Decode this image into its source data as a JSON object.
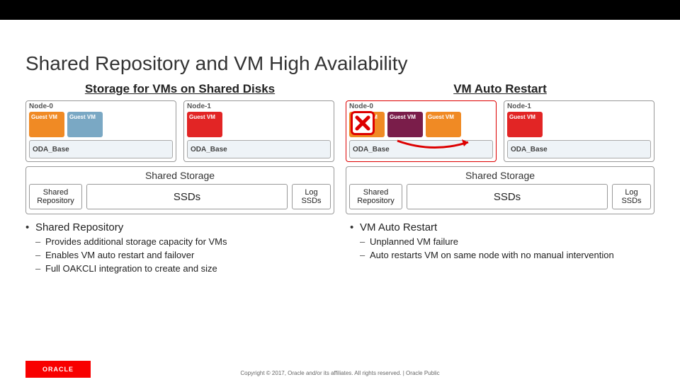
{
  "title": "Shared Repository and VM High Availability",
  "left_subheading": "Storage for VMs on Shared Disks",
  "right_subheading": "VM Auto Restart",
  "labels": {
    "node0": "Node-0",
    "node1": "Node-1",
    "guest_vm": "Guest VM",
    "oda_base": "ODA_Base",
    "shared_storage": "Shared Storage",
    "shared_repository": "Shared Repository",
    "ssds": "SSDs",
    "log_ssds": "Log SSDs"
  },
  "left_bullets": {
    "header": "Shared Repository",
    "items": [
      "Provides additional storage capacity for VMs",
      "Enables VM auto restart and failover",
      "Full OAKCLI integration to create and size"
    ]
  },
  "right_bullets": {
    "header": "VM Auto Restart",
    "items": [
      "Unplanned VM failure",
      "Auto restarts VM on same node with no manual intervention"
    ]
  },
  "footer": {
    "logo": "ORACLE",
    "copyright": "Copyright © 2017, Oracle and/or its affiliates. All rights reserved.   |   Oracle Public"
  }
}
